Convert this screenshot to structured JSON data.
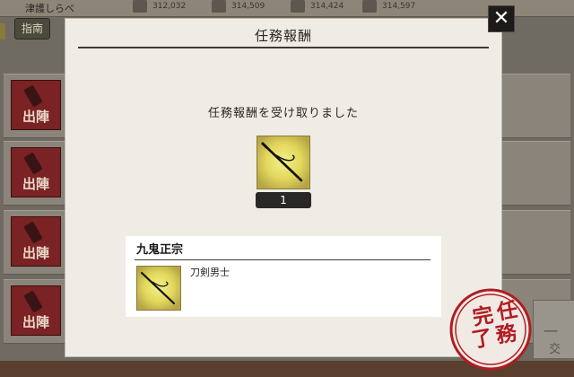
{
  "background": {
    "header_text": "津護しらべ",
    "stats": [
      "312,032",
      "314,509",
      "314,424",
      "314,597"
    ],
    "guide_label": "指南",
    "sortie_label": "出陣",
    "sortie_count": 4,
    "right_panel_text": "一",
    "right_panel_subtext": "交"
  },
  "modal": {
    "title": "任務報酬",
    "close_label": "✕",
    "message": "任務報酬を受け取りました",
    "reward": {
      "icon": "sword-item-icon",
      "count": "1"
    },
    "detail": {
      "name": "九鬼正宗",
      "type": "刀剣男士",
      "icon": "sword-thumbnail-icon"
    }
  },
  "stamp": {
    "chars": [
      "完",
      "任",
      "了",
      "務"
    ],
    "color": "#b01c22"
  },
  "colors": {
    "modal_bg": "#efece6",
    "sortie_red": "#7a2224",
    "item_gold": "#e8e070",
    "stamp_red": "#b01c22"
  }
}
